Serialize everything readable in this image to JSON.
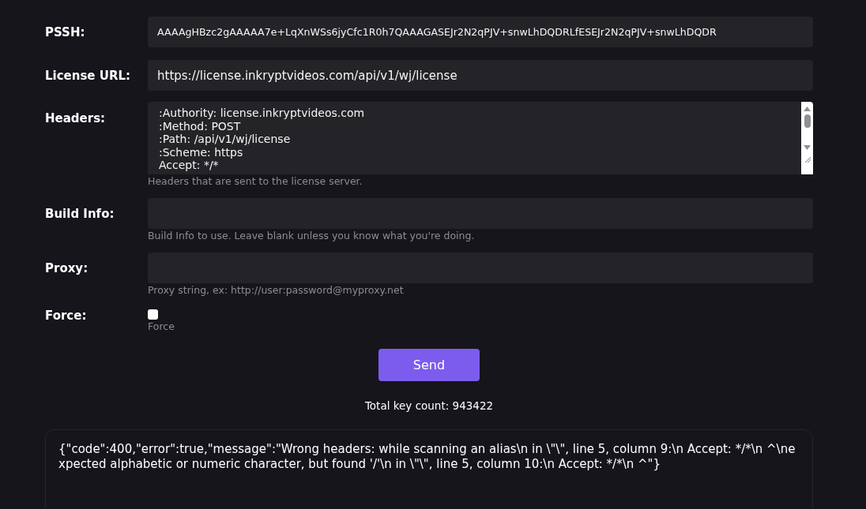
{
  "fields": [
    {
      "kind": "input",
      "label": "PSSH:",
      "value": "AAAAgHBzc2gAAAAA7e+LqXnWSs6jyCfc1R0h7QAAAGASEJr2N2qPJV+snwLhDQDRLfESEJr2N2qPJV+snwLhDQDR"
    },
    {
      "kind": "input",
      "label": "License URL:",
      "value": "https://license.inkryptvideos.com/api/v1/wj/license"
    },
    {
      "kind": "textarea",
      "label": "Headers:",
      "lines": [
        ":Authority: license.inkryptvideos.com",
        ":Method: POST",
        ":Path: /api/v1/wj/license",
        ":Scheme: https",
        "Accept: */*"
      ],
      "hint": "Headers that are sent to the license server."
    },
    {
      "kind": "input",
      "label": "Build Info:",
      "hint": "Build Info to use. Leave blank unless you know what you're doing."
    },
    {
      "kind": "input",
      "label": "Proxy:",
      "hint": "Proxy string, ex: http://user:password@myproxy.net"
    },
    {
      "kind": "checkbox",
      "label": "Force:",
      "checked": false,
      "hint": "Force"
    }
  ],
  "send_button": "Send",
  "key_count": "Total key count: 943422",
  "response": "{\"code\":400,\"error\":true,\"message\":\"Wrong headers: while scanning an alias\\n in \\\"\\\", line 5, column 9:\\n Accept: */*\\n ^\\nexpected alphabetic or numeric character, but found '/'\\n in \\\"\\\", line 5, column 10:\\n Accept: */*\\n ^\"}"
}
